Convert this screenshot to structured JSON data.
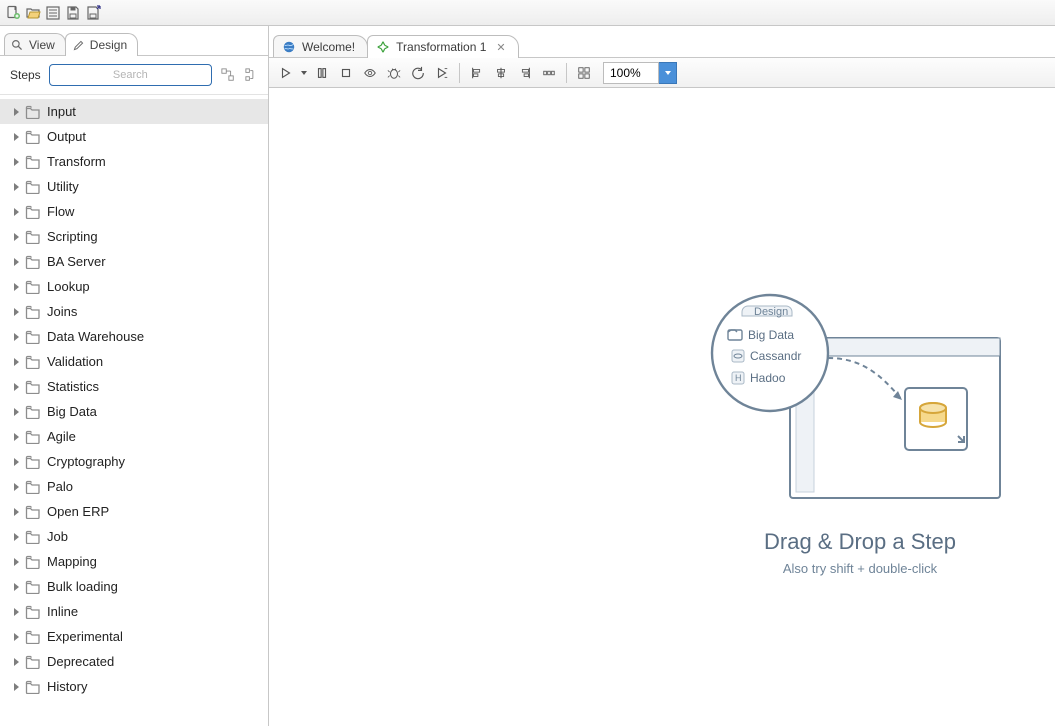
{
  "top_toolbar": {
    "buttons": [
      "new-file",
      "open-file",
      "toggle-tree",
      "save",
      "save-as"
    ]
  },
  "left_panel": {
    "tabs": {
      "view": "View",
      "design": "Design"
    },
    "active_tab": "design",
    "steps_label": "Steps",
    "search_placeholder": "Search",
    "categories": [
      "Input",
      "Output",
      "Transform",
      "Utility",
      "Flow",
      "Scripting",
      "BA Server",
      "Lookup",
      "Joins",
      "Data Warehouse",
      "Validation",
      "Statistics",
      "Big Data",
      "Agile",
      "Cryptography",
      "Palo",
      "Open ERP",
      "Job",
      "Mapping",
      "Bulk loading",
      "Inline",
      "Experimental",
      "Deprecated",
      "History"
    ],
    "selected_index": 0
  },
  "editor": {
    "tabs": [
      {
        "label": "Welcome!",
        "icon": "globe-icon",
        "closable": false
      },
      {
        "label": "Transformation 1",
        "icon": "transformation-icon",
        "closable": true
      }
    ],
    "active_tab_index": 1,
    "toolbar": [
      "run",
      "run-dropdown",
      "pause",
      "stop",
      "preview",
      "debug",
      "replay",
      "run-options",
      "sep",
      "align-left",
      "align-center",
      "align-right",
      "distribute",
      "sep",
      "grid"
    ],
    "zoom": {
      "value": "100%"
    },
    "hint": {
      "design_tab": "Design",
      "folder": "Big Data",
      "item1": "Cassandr",
      "item2": "Hadoo",
      "title": "Drag & Drop a Step",
      "subtitle": "Also try shift + double-click"
    }
  }
}
